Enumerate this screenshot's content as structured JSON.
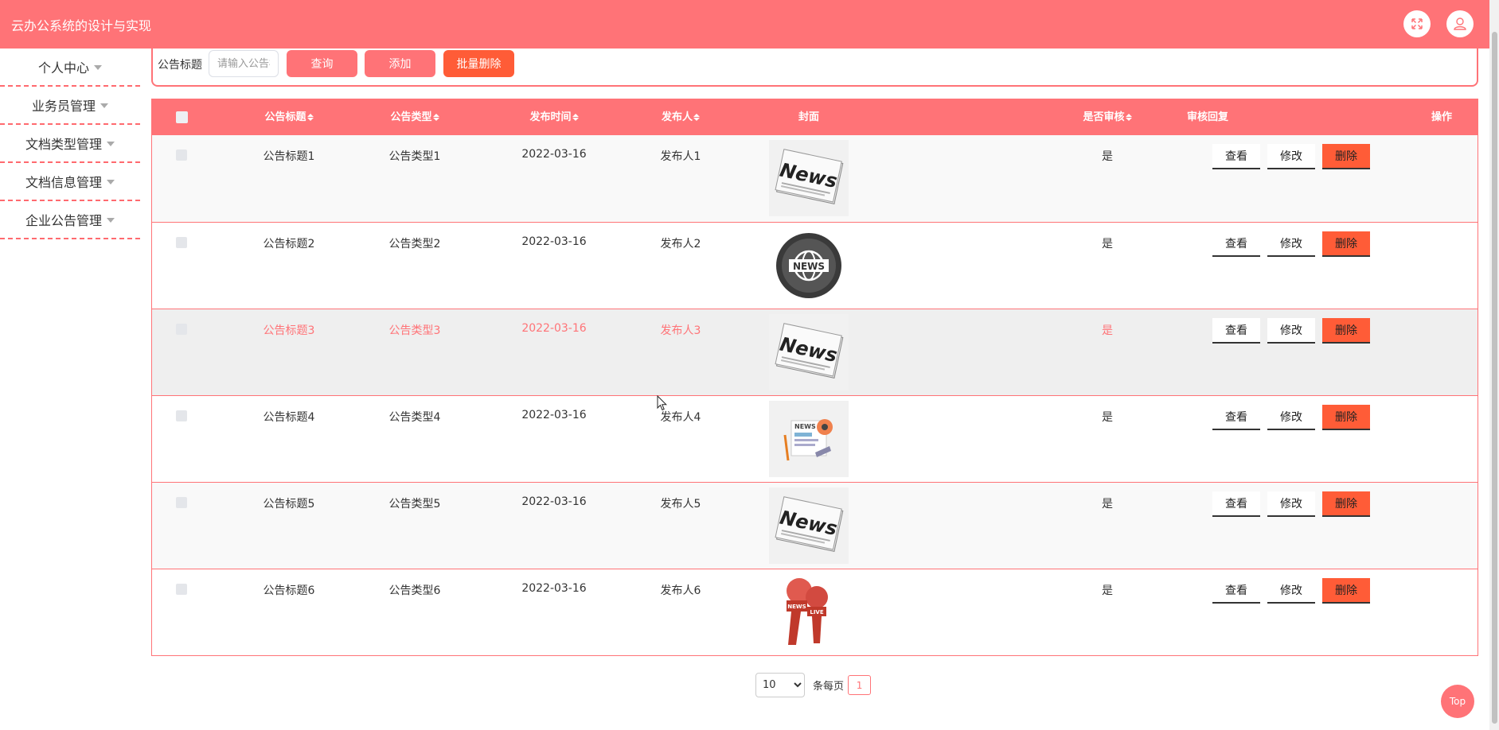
{
  "header": {
    "title": "云办公系统的设计与实现",
    "icons": [
      "fullscreen-icon",
      "user-icon"
    ],
    "accent_color": "#ff7377"
  },
  "sidebar": {
    "items": [
      {
        "label": "个人中心"
      },
      {
        "label": "业务员管理"
      },
      {
        "label": "文档类型管理"
      },
      {
        "label": "文档信息管理"
      },
      {
        "label": "企业公告管理"
      }
    ]
  },
  "search": {
    "label": "公告标题",
    "placeholder": "请输入公告标题",
    "query_label": "查询",
    "add_label": "添加",
    "batch_delete_label": "批量删除"
  },
  "table": {
    "columns": {
      "title": "公告标题",
      "type": "公告类型",
      "time": "发布时间",
      "publisher": "发布人",
      "cover": "封面",
      "reviewed": "是否审核",
      "reply": "审核回复",
      "actions": "操作"
    },
    "rows": [
      {
        "title": "公告标题1",
        "type": "公告类型1",
        "time": "2022-03-16",
        "publisher": "发布人1",
        "reviewed": "是",
        "reply": "",
        "cover": "newspaper-icon"
      },
      {
        "title": "公告标题2",
        "type": "公告类型2",
        "time": "2022-03-16",
        "publisher": "发布人2",
        "reviewed": "是",
        "reply": "",
        "cover": "globe-news-icon"
      },
      {
        "title": "公告标题3",
        "type": "公告类型3",
        "time": "2022-03-16",
        "publisher": "发布人3",
        "reviewed": "是",
        "reply": "",
        "cover": "newspaper-icon"
      },
      {
        "title": "公告标题4",
        "type": "公告类型4",
        "time": "2022-03-16",
        "publisher": "发布人4",
        "reviewed": "是",
        "reply": "",
        "cover": "news-illustration-icon"
      },
      {
        "title": "公告标题5",
        "type": "公告类型5",
        "time": "2022-03-16",
        "publisher": "发布人5",
        "reviewed": "是",
        "reply": "",
        "cover": "newspaper-icon"
      },
      {
        "title": "公告标题6",
        "type": "公告类型6",
        "time": "2022-03-16",
        "publisher": "发布人6",
        "reviewed": "是",
        "reply": "",
        "cover": "live-microphone-icon"
      }
    ],
    "actions": {
      "view": "查看",
      "edit": "修改",
      "delete": "删除"
    }
  },
  "pagination": {
    "page_size": "10",
    "per_page_label": "条每页",
    "current_page": "1"
  },
  "top_button": "Top"
}
